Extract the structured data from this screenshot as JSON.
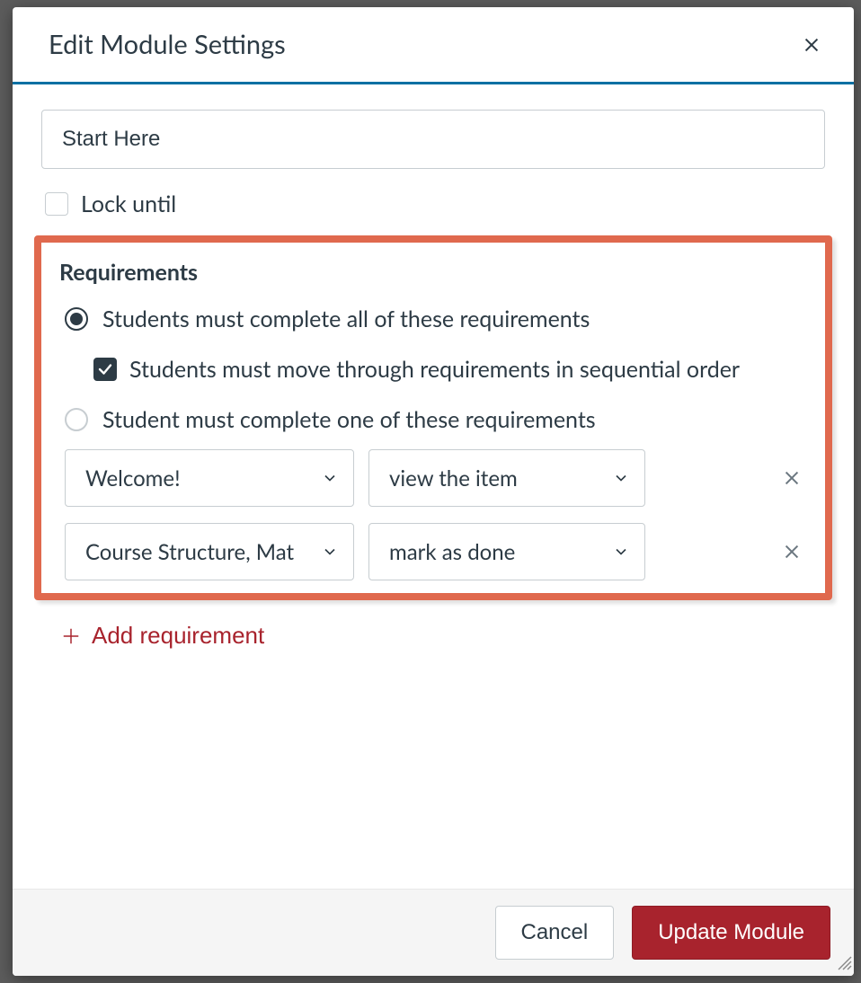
{
  "modal": {
    "title": "Edit Module Settings"
  },
  "form": {
    "module_name_value": "Start Here",
    "lock_until_label": "Lock until",
    "lock_until_checked": false
  },
  "requirements": {
    "heading": "Requirements",
    "option_all_label": "Students must complete all of these requirements",
    "option_all_selected": true,
    "sequential_label": "Students must move through requirements in sequential order",
    "sequential_checked": true,
    "option_one_label": "Student must complete one of these requirements",
    "option_one_selected": false,
    "rows": [
      {
        "item": "Welcome!",
        "action": "view the item"
      },
      {
        "item": "Course Structure, Mat",
        "action": "mark as done"
      }
    ],
    "add_label": "Add requirement"
  },
  "footer": {
    "cancel_label": "Cancel",
    "submit_label": "Update Module"
  }
}
